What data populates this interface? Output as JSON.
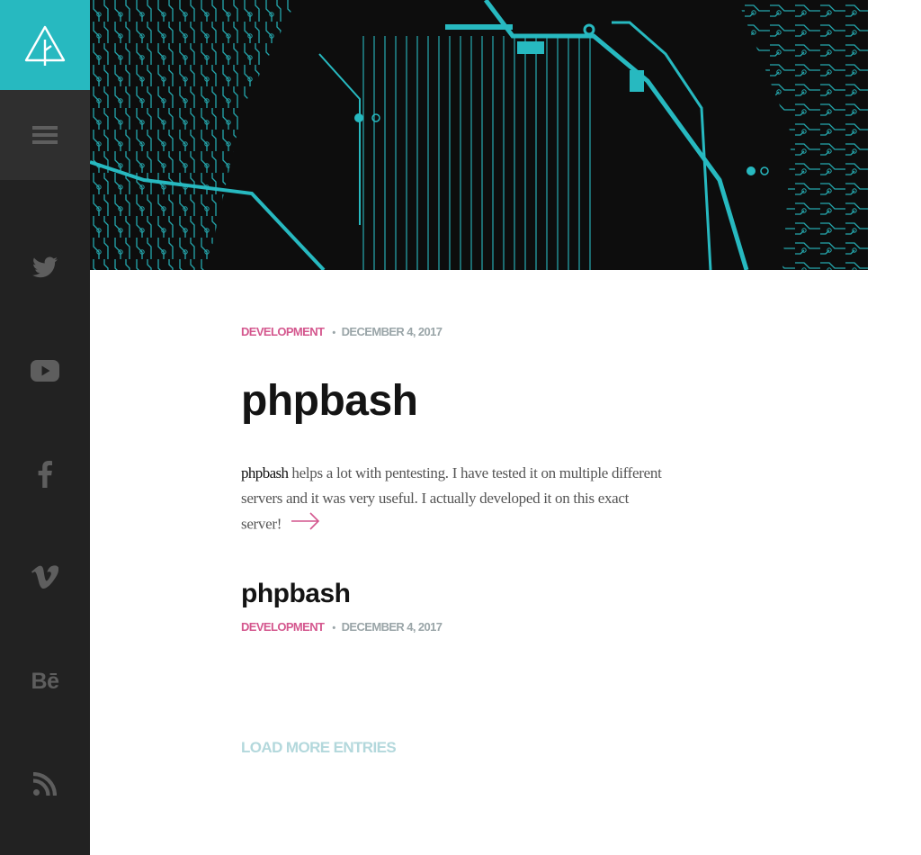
{
  "sidebar": {
    "logo_icon": "tree-triangle-logo",
    "menu_icon": "hamburger-menu-icon",
    "social": [
      {
        "name": "twitter-icon"
      },
      {
        "name": "youtube-icon"
      },
      {
        "name": "facebook-icon"
      },
      {
        "name": "vimeo-icon"
      },
      {
        "name": "behance-icon",
        "label": "Bē"
      },
      {
        "name": "rss-icon"
      }
    ]
  },
  "hero": {
    "image": "circuit-board-image",
    "accent": "#27b9c0"
  },
  "posts": [
    {
      "category": "DEVELOPMENT",
      "date": "DECEMBER 4, 2017",
      "title": "phpbash",
      "excerpt_strong": "phpbash",
      "excerpt_rest": " helps a lot with pentesting. I have tested it on multiple different servers and it was very useful. I actually developed it on this exact server!",
      "read_more_icon": "arrow-right-icon"
    },
    {
      "title": "phpbash",
      "category": "DEVELOPMENT",
      "date": "DECEMBER 4, 2017"
    }
  ],
  "load_more": "LOAD MORE ENTRIES",
  "colors": {
    "brand": "#27b9c0",
    "category": "#d4578e",
    "meta": "#9aa5a8",
    "sidebar": "#222222",
    "load_more": "#b3d8dc"
  }
}
